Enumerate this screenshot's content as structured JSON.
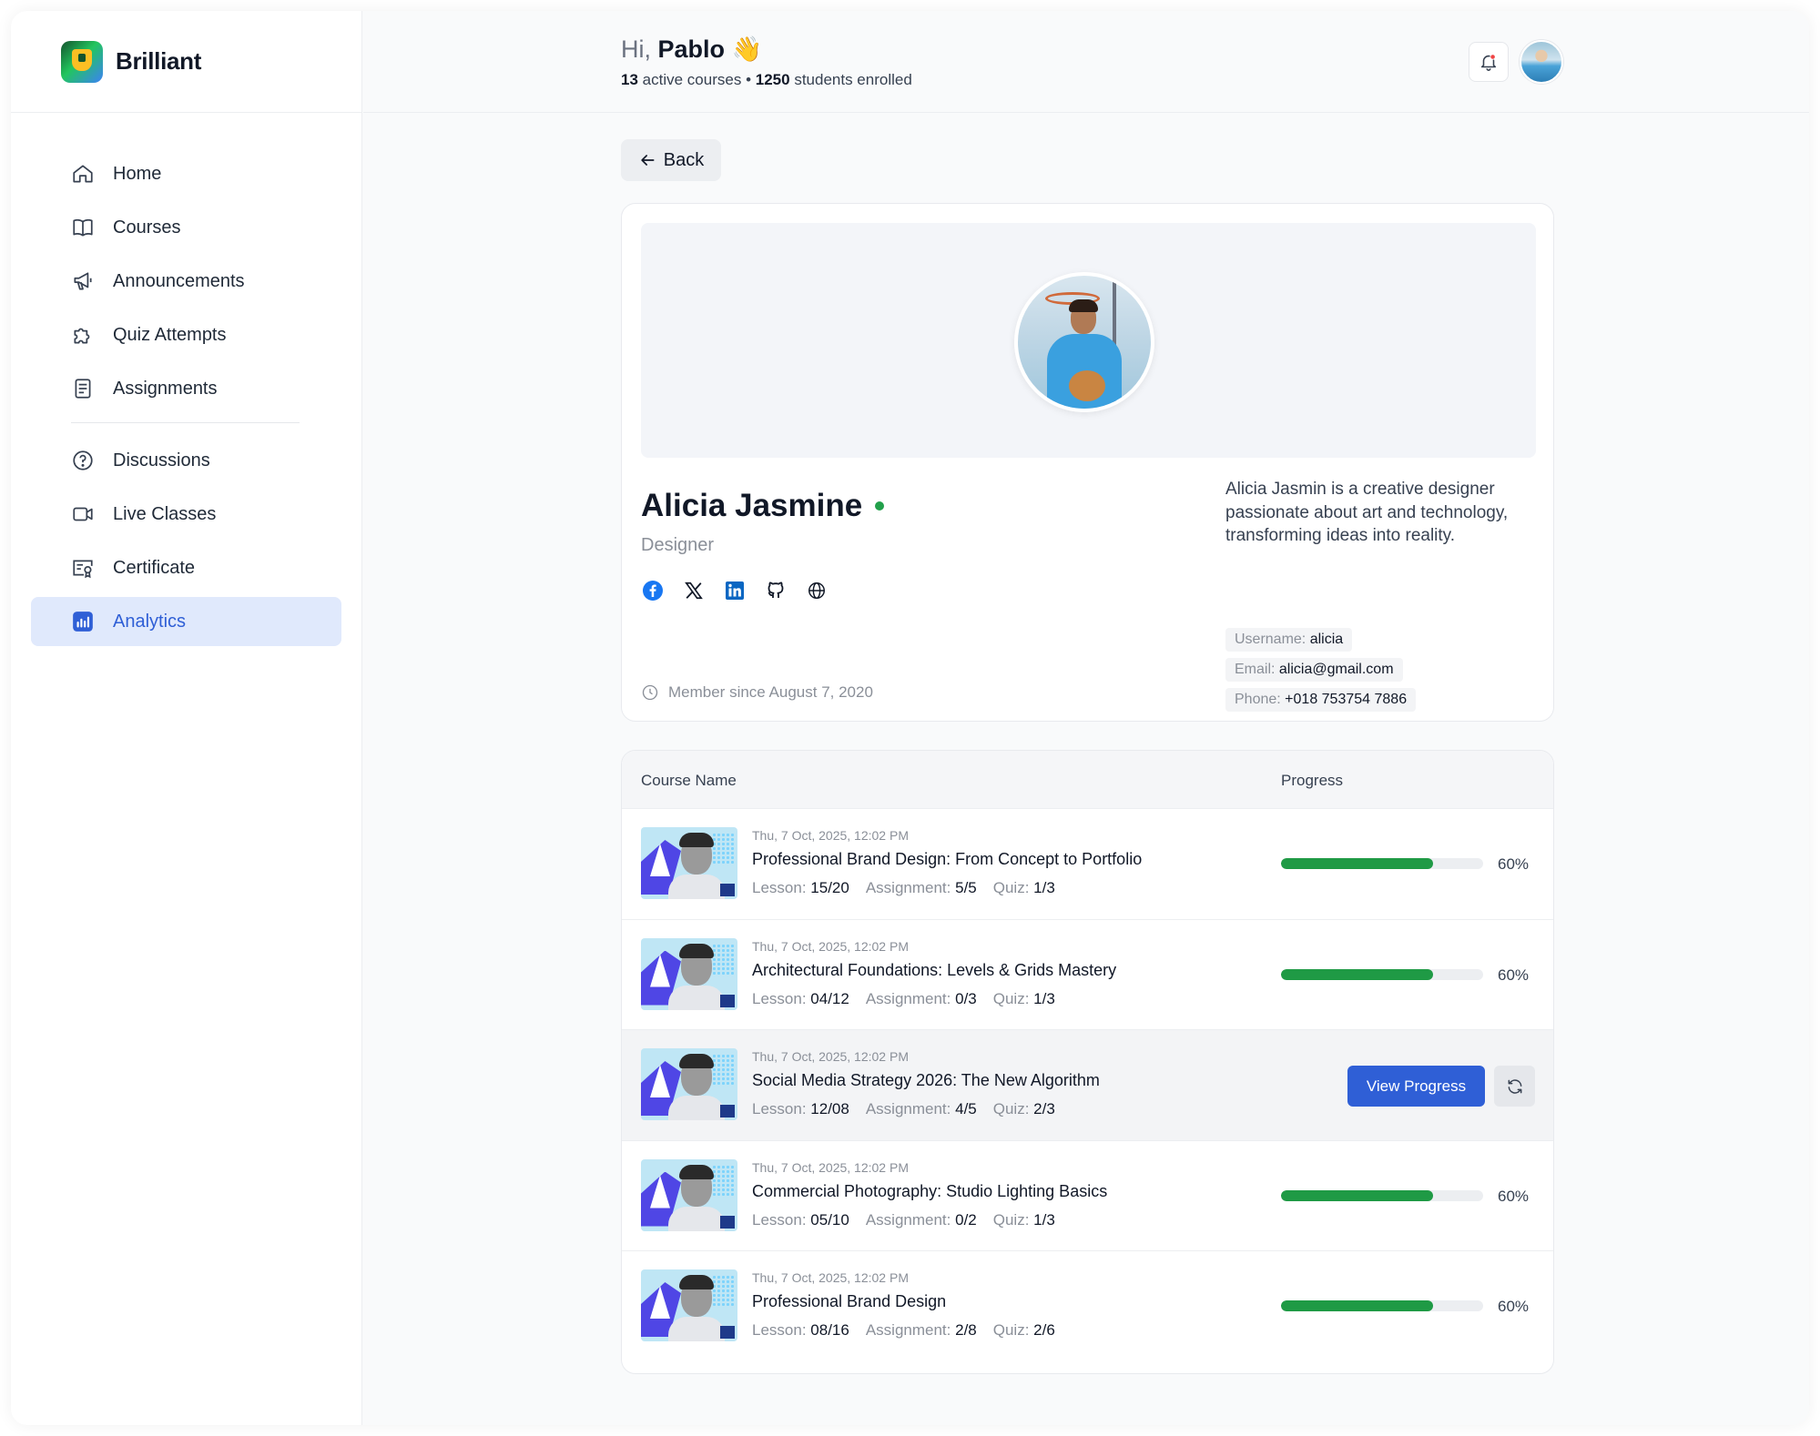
{
  "brand": {
    "name": "Brilliant"
  },
  "nav": {
    "items": [
      {
        "label": "Home",
        "icon": "home-icon"
      },
      {
        "label": "Courses",
        "icon": "book-icon"
      },
      {
        "label": "Announcements",
        "icon": "megaphone-icon"
      },
      {
        "label": "Quiz Attempts",
        "icon": "puzzle-icon"
      },
      {
        "label": "Assignments",
        "icon": "document-icon"
      },
      {
        "label": "Discussions",
        "icon": "help-circle-icon"
      },
      {
        "label": "Live Classes",
        "icon": "video-icon"
      },
      {
        "label": "Certificate",
        "icon": "certificate-icon"
      },
      {
        "label": "Analytics",
        "icon": "analytics-icon",
        "active": true
      }
    ]
  },
  "header": {
    "greeting": "Hi,",
    "user_name": "Pablo",
    "wave": "👋",
    "active_courses_count": "13",
    "active_courses_label": "active courses",
    "separator": "•",
    "students_count": "1250",
    "students_label": "students enrolled"
  },
  "back_label": "Back",
  "profile": {
    "name": "Alicia Jasmine",
    "role": "Designer",
    "bio": "Alicia Jasmin is a creative designer passionate about art and technology, transforming ideas into reality.",
    "member_since": "Member since August 7, 2020",
    "username_label": "Username:",
    "username": "alicia",
    "email_label": "Email:",
    "email": "alicia@gmail.com",
    "phone_label": "Phone:",
    "phone": "+018 753754 7886",
    "socials": [
      "facebook-icon",
      "x-icon",
      "linkedin-icon",
      "github-icon",
      "globe-icon"
    ]
  },
  "table": {
    "col_name": "Course Name",
    "col_progress": "Progress",
    "lesson_label": "Lesson:",
    "assignment_label": "Assignment:",
    "quiz_label": "Quiz:",
    "view_progress_label": "View Progress",
    "rows": [
      {
        "date": "Thu, 7 Oct, 2025, 12:02 PM",
        "title": "Professional Brand Design: From Concept to Portfolio",
        "lesson": "15/20",
        "assignment": "5/5",
        "quiz": "1/3",
        "progress": 0.75,
        "progress_label": "60%"
      },
      {
        "date": "Thu, 7 Oct, 2025, 12:02 PM",
        "title": "Architectural Foundations: Levels & Grids Mastery",
        "lesson": "04/12",
        "assignment": "0/3",
        "quiz": "1/3",
        "progress": 0.75,
        "progress_label": "60%"
      },
      {
        "date": "Thu, 7 Oct, 2025, 12:02 PM",
        "title": "Social Media Strategy 2026: The New Algorithm",
        "lesson": "12/08",
        "assignment": "4/5",
        "quiz": "2/3",
        "hovered": true
      },
      {
        "date": "Thu, 7 Oct, 2025, 12:02 PM",
        "title": "Commercial Photography: Studio Lighting Basics",
        "lesson": "05/10",
        "assignment": "0/2",
        "quiz": "1/3",
        "progress": 0.75,
        "progress_label": "60%"
      },
      {
        "date": "Thu, 7 Oct, 2025, 12:02 PM",
        "title": "Professional Brand Design",
        "lesson": "08/16",
        "assignment": "2/8",
        "quiz": "2/6",
        "progress": 0.75,
        "progress_label": "60%"
      }
    ]
  },
  "colors": {
    "accent": "#2f5fd6",
    "active_nav_bg": "#e0e9fc",
    "progress_green": "#1f9a45",
    "online_green": "#22a04b"
  }
}
